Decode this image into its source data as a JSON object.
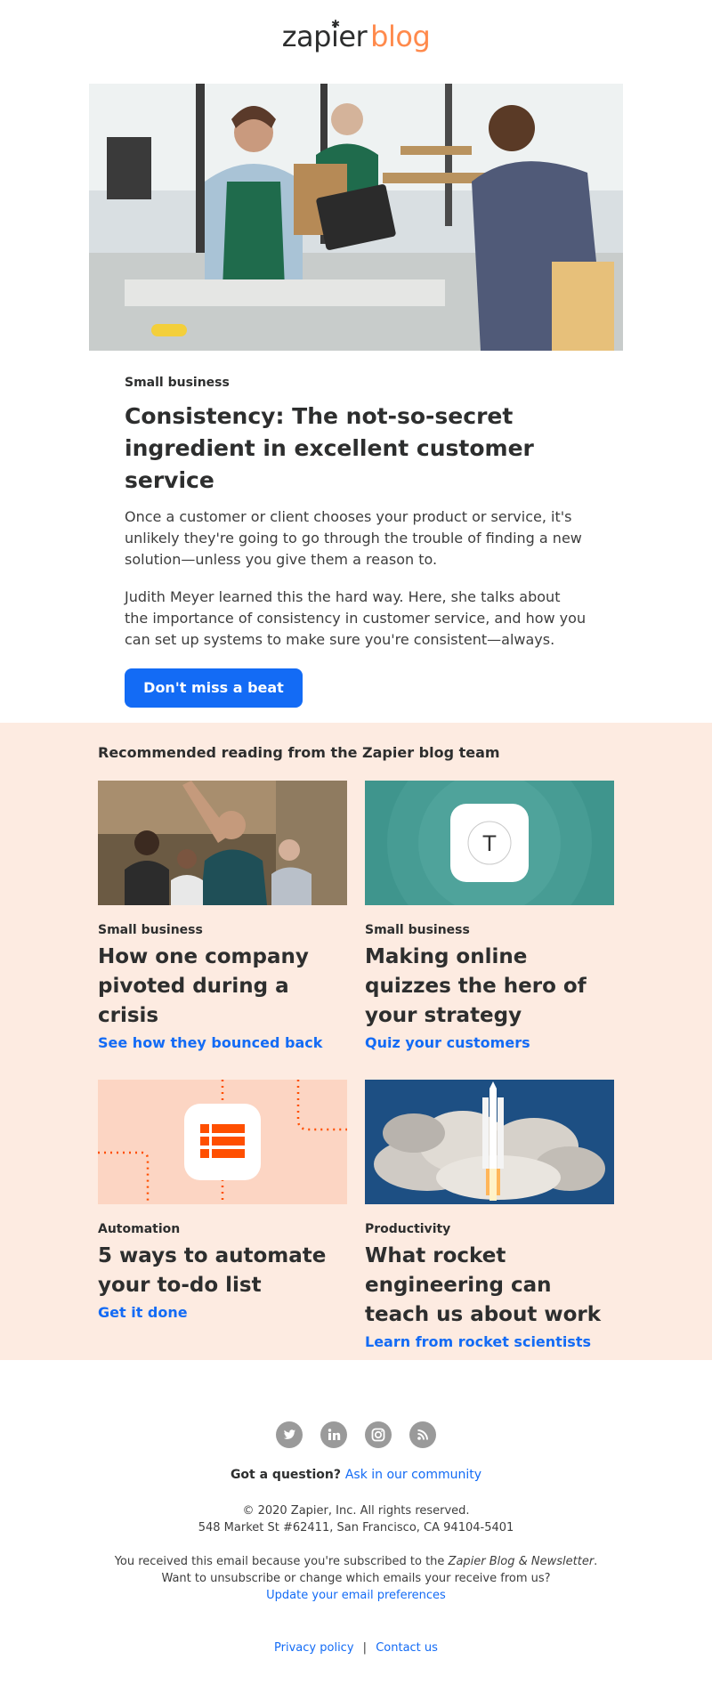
{
  "logo": {
    "part1": "zapier",
    "part2": "blog"
  },
  "article": {
    "category": "Small business",
    "title": "Consistency: The not-so-secret ingredient in excellent customer service",
    "paragraph1": "Once a customer or client chooses your product or service, it's unlikely they're going to go through the trouble of finding a new solution—unless you give them a reason to.",
    "paragraph2": "Judith Meyer learned this the hard way. Here, she talks about the importance of consistency in customer service, and how you can set up systems to make sure you're consistent—always.",
    "cta_label": "Don't miss a beat"
  },
  "recommended": {
    "heading": "Recommended reading from the Zapier blog team",
    "cards": [
      {
        "category": "Small business",
        "title": "How one company pivoted during a crisis",
        "link": "See how they bounced back"
      },
      {
        "category": "Small business",
        "title": "Making online quizzes the hero of your strategy",
        "link": "Quiz your customers",
        "icon_letter": "T"
      },
      {
        "category": "Automation",
        "title": "5 ways to automate your to-do list",
        "link": "Get it done"
      },
      {
        "category": "Productivity",
        "title": "What rocket engineering can teach us about work",
        "link": "Learn from rocket scientists"
      }
    ]
  },
  "footer": {
    "question": "Got a question?",
    "community_link": "Ask in our community",
    "copyright": "© 2020 Zapier, Inc. All rights reserved.",
    "address": "548 Market St #62411, San Francisco, CA 94104-5401",
    "received_prefix": "You received this email because you're subscribed to the",
    "newsletter_name": "Zapier Blog & Newsletter",
    "received_suffix": ".",
    "unsubscribe_text": "Want to unsubscribe or change which emails your receive from us?",
    "preferences_link": "Update your email preferences",
    "privacy_link": "Privacy policy",
    "separator": "|",
    "contact_link": "Contact us"
  },
  "social_icons": [
    "twitter-icon",
    "linkedin-icon",
    "instagram-icon",
    "rss-icon"
  ],
  "colors": {
    "accent": "#136bf5",
    "brand_orange": "#ff8a4c",
    "rec_background": "#fdebe1",
    "quiz_teal": "#3f958d",
    "todo_orange": "#ff4f00",
    "rocket_sky": "#1d4f83"
  }
}
